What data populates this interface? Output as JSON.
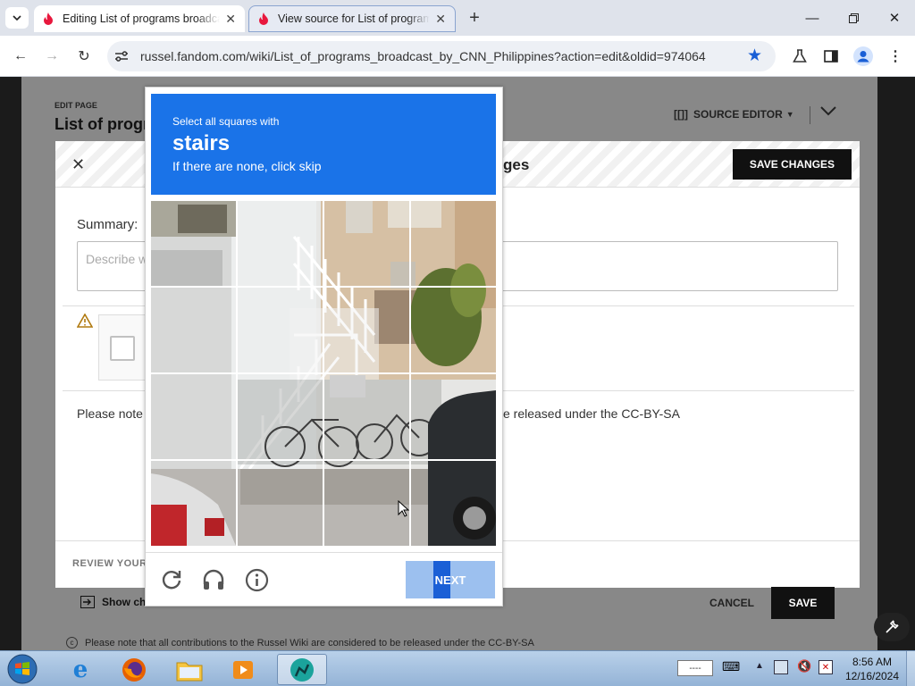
{
  "browser": {
    "tabs": [
      {
        "title": "Editing List of programs broadcast by CNN Philippines",
        "active": true
      },
      {
        "title": "View source for List of programs broadcast by CNN Philippines",
        "active": false
      }
    ],
    "url": "russel.fandom.com/wiki/List_of_programs_broadcast_by_CNN_Philippines?action=edit&oldid=974064",
    "new_tab_icon": "plus-icon"
  },
  "editor": {
    "edit_page_label": "EDIT PAGE",
    "page_title": "List of progr",
    "source_editor_label": "SOURCE EDITOR",
    "dialog_title_fragment": "ges",
    "save_changes_label": "SAVE CHANGES",
    "summary_label": "Summary:",
    "summary_placeholder": "Describe w",
    "note_fragment_left": "Please note",
    "note_fragment_right": "e released under the CC-BY-SA",
    "review_label": "REVIEW YOUR",
    "show_changes_label": "Show ch",
    "cancel_label": "CANCEL",
    "save_label": "SAVE",
    "footer_note": "Please note that all contributions to the Russel Wiki are considered to be released under the CC-BY-SA"
  },
  "captcha": {
    "instruction": "Select all squares with",
    "target": "stairs",
    "subtext": "If there are none, click skip",
    "next_label": "NEXT",
    "grid_rows": 4,
    "grid_cols": 4
  },
  "taskbar": {
    "time": "8:56 AM",
    "date": "12/16/2024",
    "language": "----"
  },
  "colors": {
    "captcha_blue": "#1a73e8",
    "next_disabled": "#9cc0ef"
  }
}
